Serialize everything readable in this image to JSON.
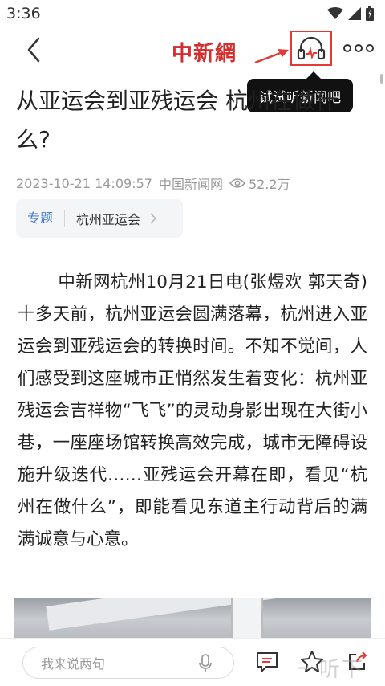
{
  "status_bar": {
    "time": "3:36"
  },
  "nav": {
    "brand": "中新網"
  },
  "tooltip": {
    "text": "试试听新闻吧"
  },
  "article": {
    "title": "从亚运会到亚残运会 杭州在做什么?",
    "date": "2023-10-21 14:09:57",
    "source": "中国新闻网",
    "views": "52.2万",
    "topic_label": "专题",
    "topic_name": "杭州亚运会",
    "body": "中新网杭州10月21日电(张煜欢 郭天奇)十多天前，杭州亚运会圆满落幕，杭州进入亚运会到亚残运会的转换时间。不知不觉间，人们感受到这座城市正悄然发生着变化：杭州亚残运会吉祥物“飞飞”的灵动身影出现在大街小巷，一座座场馆转换高效完成，城市无障碍设施升级迭代……亚残运会开幕在即，看见“杭州在做什么”，即能看见东道主行动背后的满满诚意与心意。"
  },
  "bottom_bar": {
    "comment_placeholder": "我来说两句"
  },
  "watermark": "一听下载",
  "colors": {
    "brand_red": "#d52e2e",
    "highlight_red": "#e53935",
    "topic_blue": "#4a7bd0"
  }
}
